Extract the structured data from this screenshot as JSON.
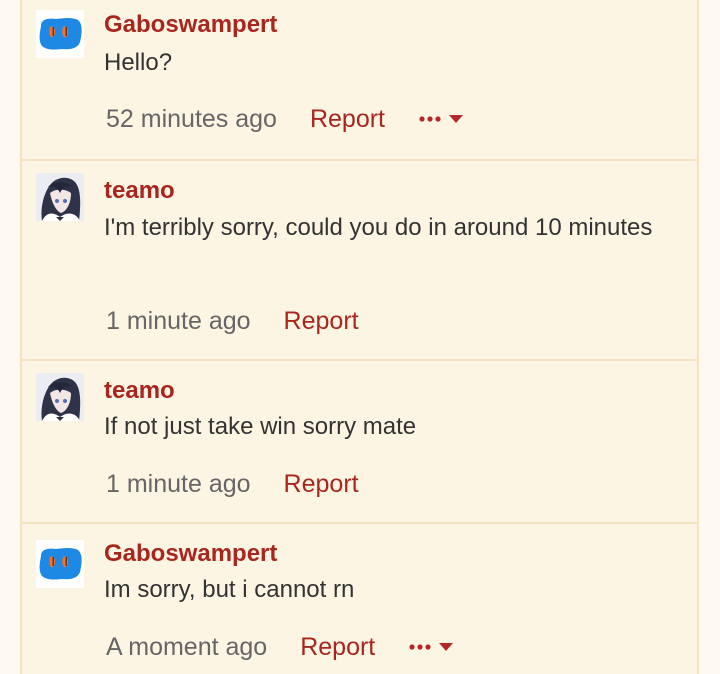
{
  "comments": [
    {
      "author": "Gaboswampert",
      "text": "Hello?",
      "time": "52 minutes ago",
      "report": "Report",
      "has_more": true
    },
    {
      "author": "teamo",
      "text": "I'm terribly sorry, could you do in around 10 minutes",
      "time": "1 minute ago",
      "report": "Report",
      "has_more": false
    },
    {
      "author": "teamo",
      "text": "If not just take win sorry mate",
      "time": "1 minute ago",
      "report": "Report",
      "has_more": false
    },
    {
      "author": "Gaboswampert",
      "text": "Im sorry, but i cannot rn",
      "time": "A moment ago",
      "report": "Report",
      "has_more": true
    }
  ],
  "colors": {
    "author": "#a7261e",
    "link": "#a7261e",
    "card_bg": "#fdf5e3",
    "border": "#f4e3c1"
  },
  "icons": {
    "gaboswampert_avatar": "blue-blob-avatar-icon",
    "teamo_avatar": "anime-character-avatar-icon",
    "more": "more-options-icon"
  }
}
